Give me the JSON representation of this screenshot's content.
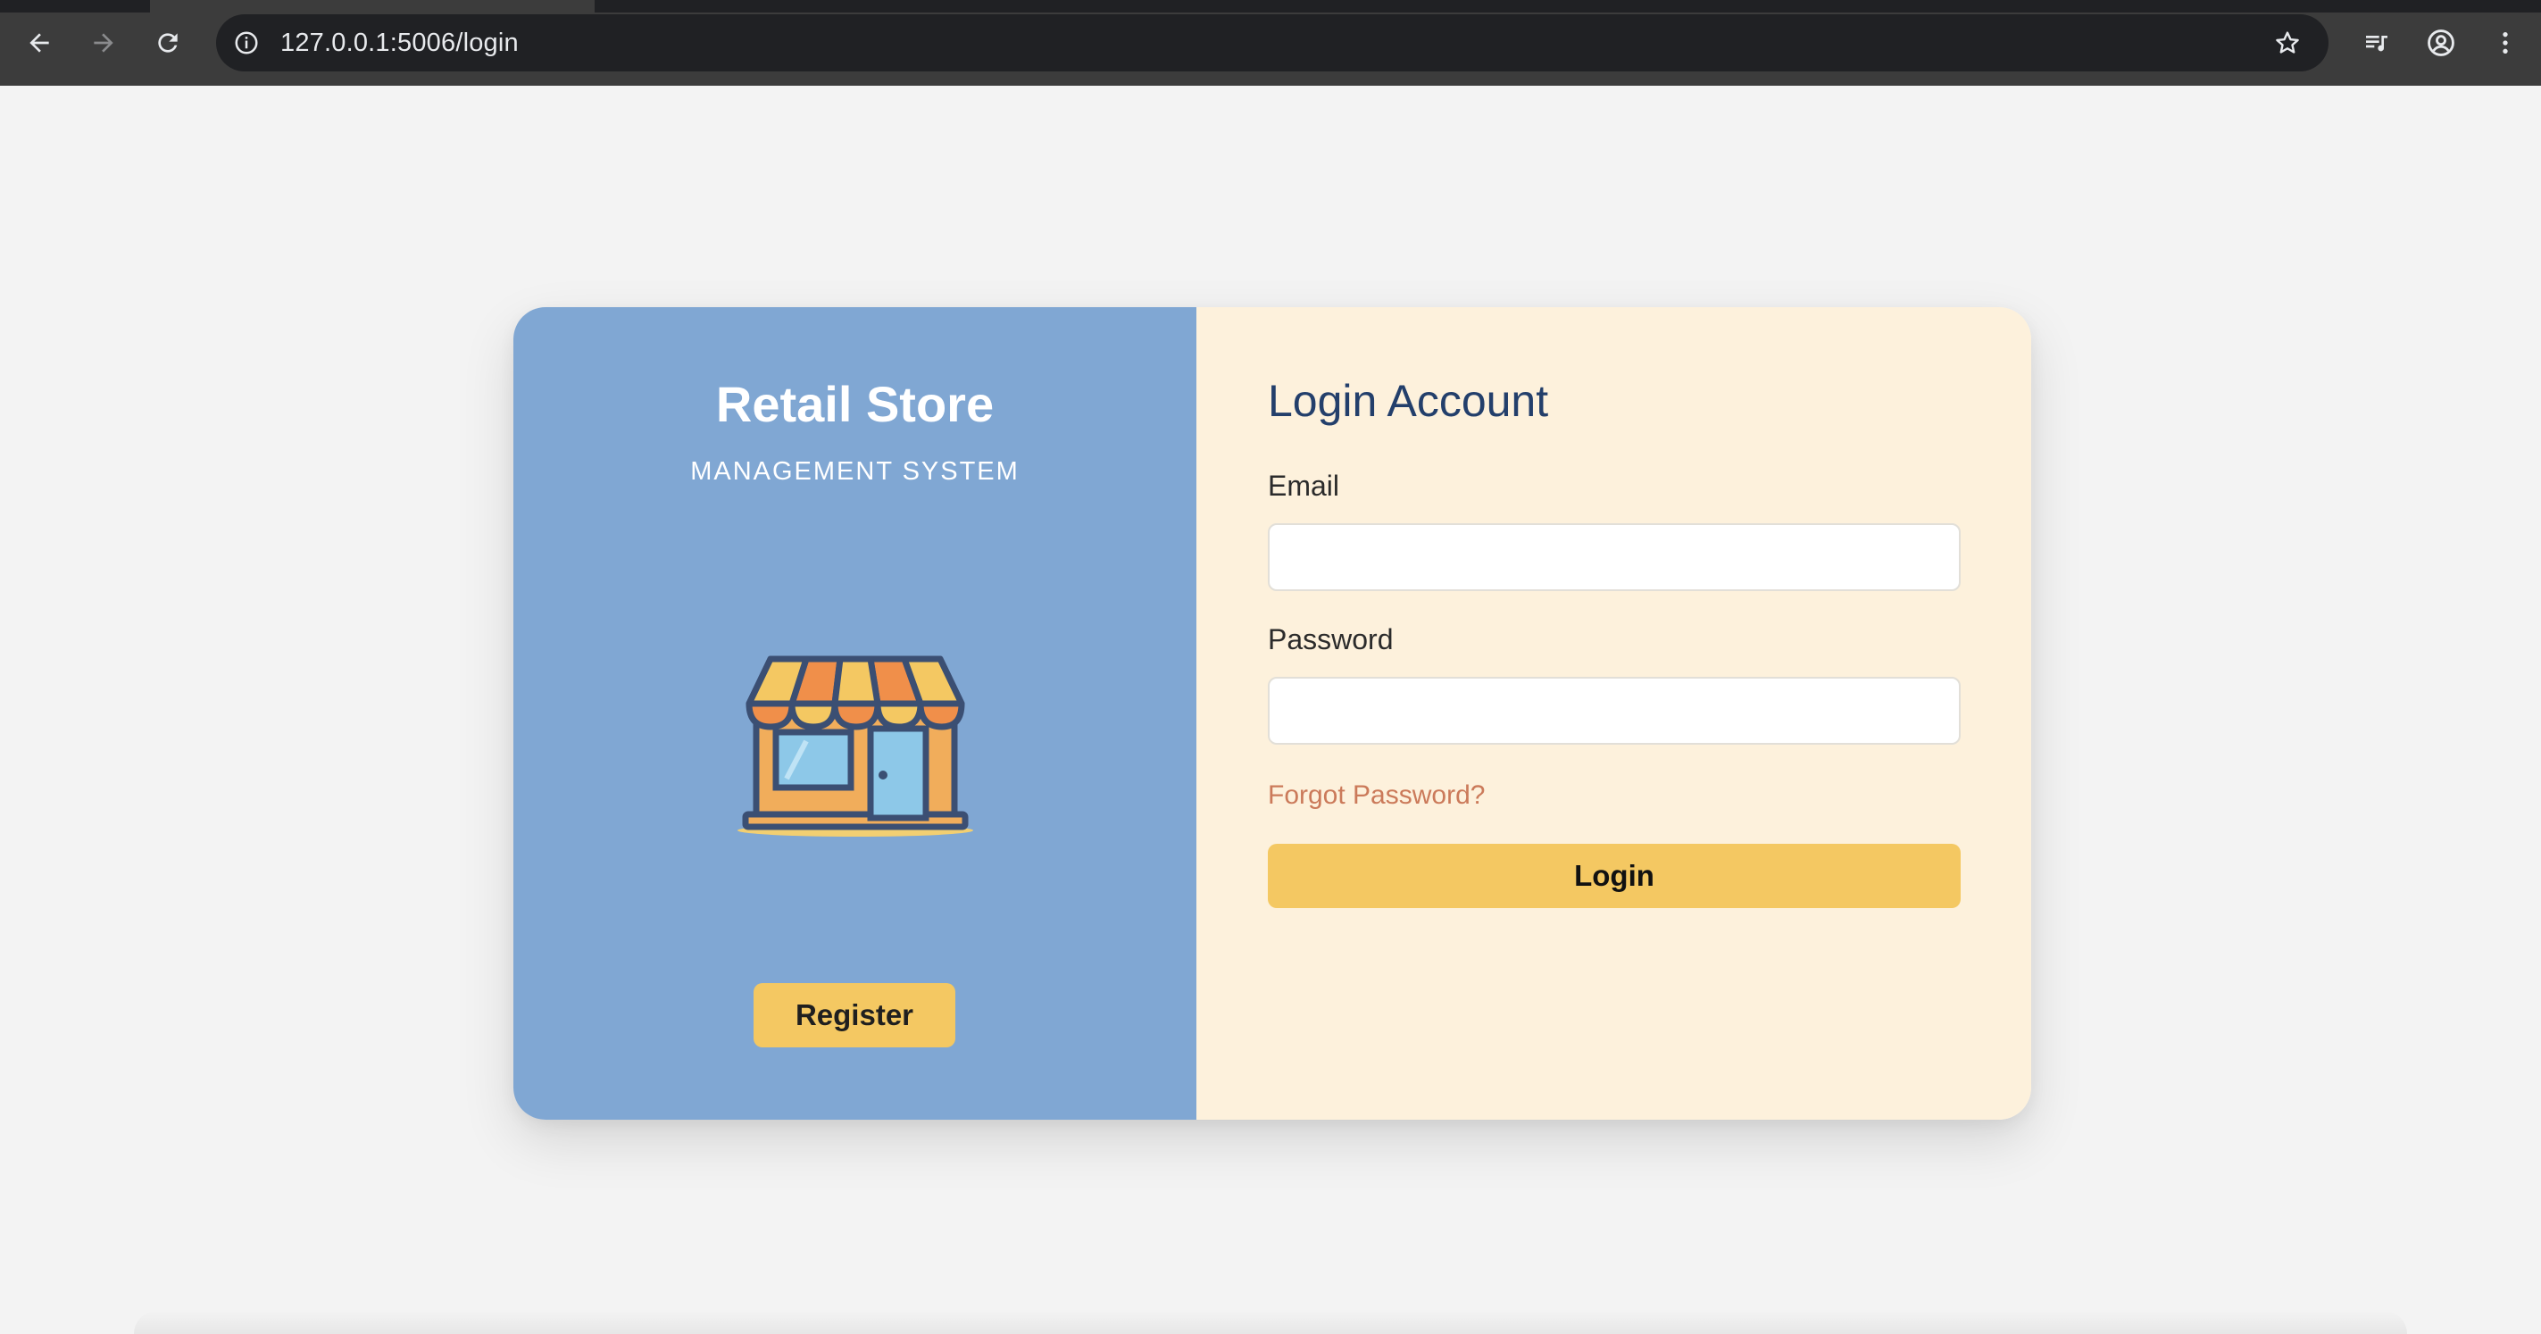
{
  "browser": {
    "url": "127.0.0.1:5006/login",
    "icons": {
      "back": "back-arrow-icon",
      "forward": "forward-arrow-icon",
      "reload": "reload-icon",
      "site_info": "info-icon",
      "bookmark": "star-icon",
      "media": "media-playlist-icon",
      "profile": "profile-icon",
      "menu": "kebab-menu-icon"
    }
  },
  "brand": {
    "title": "Retail Store",
    "subtitle": "MANAGEMENT SYSTEM",
    "illustration": "storefront-icon",
    "register_label": "Register"
  },
  "login": {
    "title": "Login Account",
    "email_label": "Email",
    "email_value": "",
    "password_label": "Password",
    "password_value": "",
    "forgot_label": "Forgot Password?",
    "submit_label": "Login"
  },
  "colors": {
    "left_panel": "#80a7d3",
    "right_panel": "#fdf1dc",
    "accent_button": "#f4c862",
    "heading": "#233f6b",
    "link": "#cb7a5a"
  }
}
